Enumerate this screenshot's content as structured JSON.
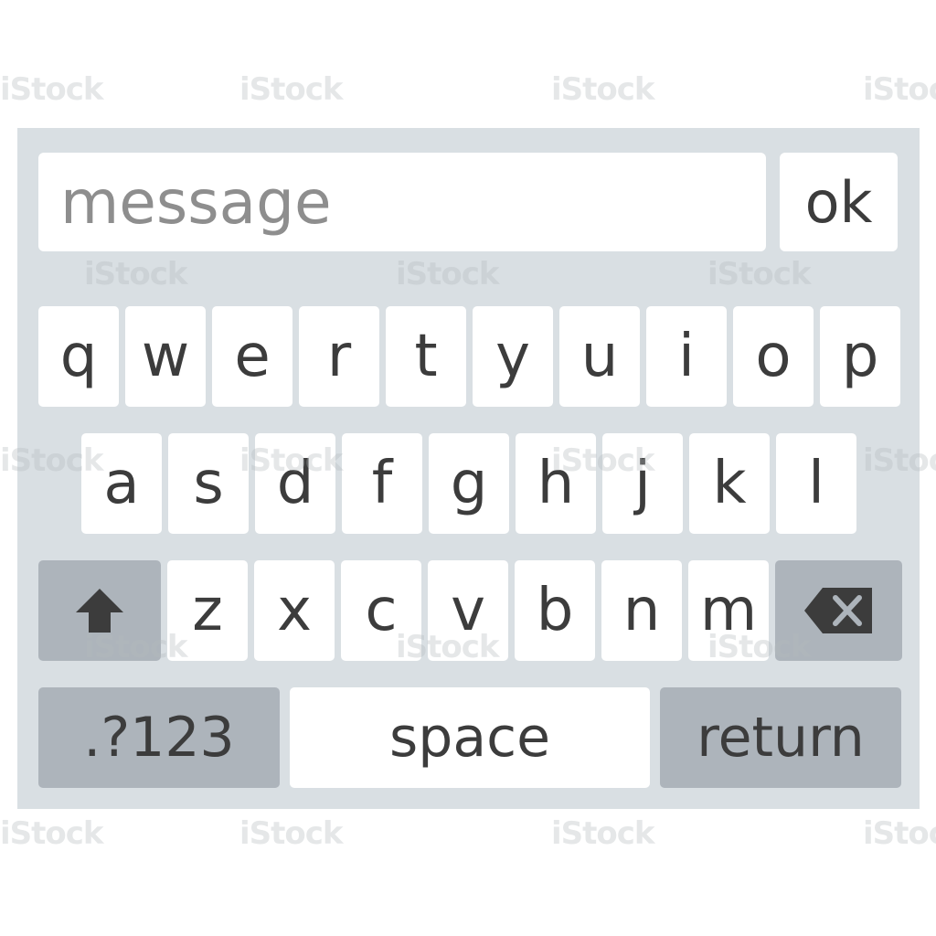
{
  "input": {
    "placeholder": "message",
    "value": ""
  },
  "ok_label": "ok",
  "rows": {
    "row1": [
      "q",
      "w",
      "e",
      "r",
      "t",
      "y",
      "u",
      "i",
      "o",
      "p"
    ],
    "row2": [
      "a",
      "s",
      "d",
      "f",
      "g",
      "h",
      "j",
      "k",
      "l"
    ],
    "row3": [
      "z",
      "x",
      "c",
      "v",
      "b",
      "n",
      "m"
    ]
  },
  "bottom": {
    "numbers_label": ".?123",
    "space_label": "space",
    "return_label": "return"
  },
  "icons": {
    "shift": "shift-arrow-up-icon",
    "backspace": "backspace-x-icon"
  },
  "watermark_text": "iStock",
  "colors": {
    "keyboard_bg": "#d9dfe3",
    "key_bg": "#ffffff",
    "special_key_bg": "#adb4bb",
    "key_text": "#3c3c3c",
    "placeholder_text": "#8e8e8e"
  }
}
